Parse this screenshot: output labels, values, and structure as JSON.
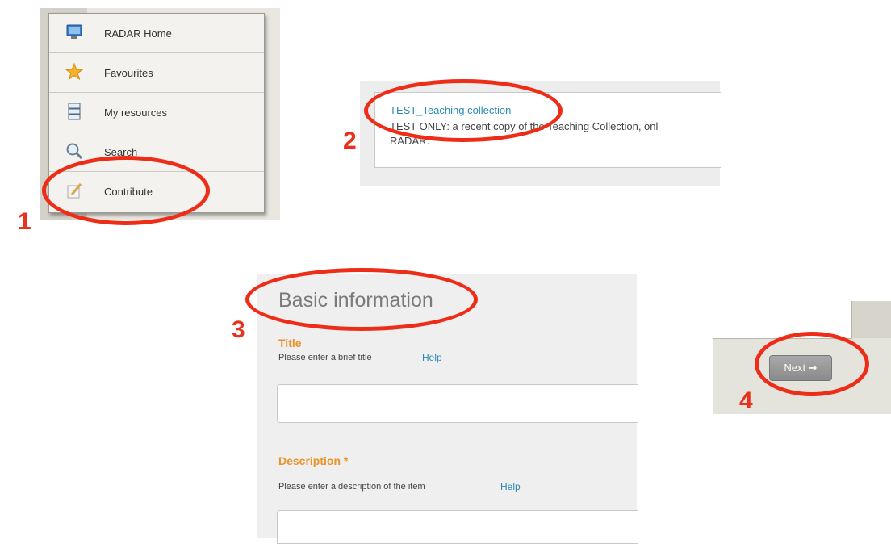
{
  "colors": {
    "highlight": "#ee2d18",
    "step_number": "#e8321e",
    "link": "#2a8ab5",
    "field_label": "#e8932b"
  },
  "steps": [
    "1",
    "2",
    "3",
    "4"
  ],
  "menu": {
    "items": [
      {
        "label": "RADAR Home",
        "icon": "monitor-icon"
      },
      {
        "label": "Favourites",
        "icon": "star-icon"
      },
      {
        "label": "My resources",
        "icon": "stack-icon"
      },
      {
        "label": "Search",
        "icon": "search-icon"
      },
      {
        "label": "Contribute",
        "icon": "pencil-icon"
      }
    ]
  },
  "collection": {
    "link": "TEST_Teaching collection",
    "description": "TEST ONLY: a recent copy of the Teaching Collection, onl",
    "description_line2": "RADAR."
  },
  "form": {
    "heading": "Basic information",
    "title_label": "Title",
    "title_hint": "Please enter a brief title",
    "title_help": "Help",
    "title_value": "",
    "description_label": "Description *",
    "description_hint": "Please enter a description of the item",
    "description_help": "Help",
    "description_value": ""
  },
  "next_button": {
    "label": "Next ➜"
  }
}
